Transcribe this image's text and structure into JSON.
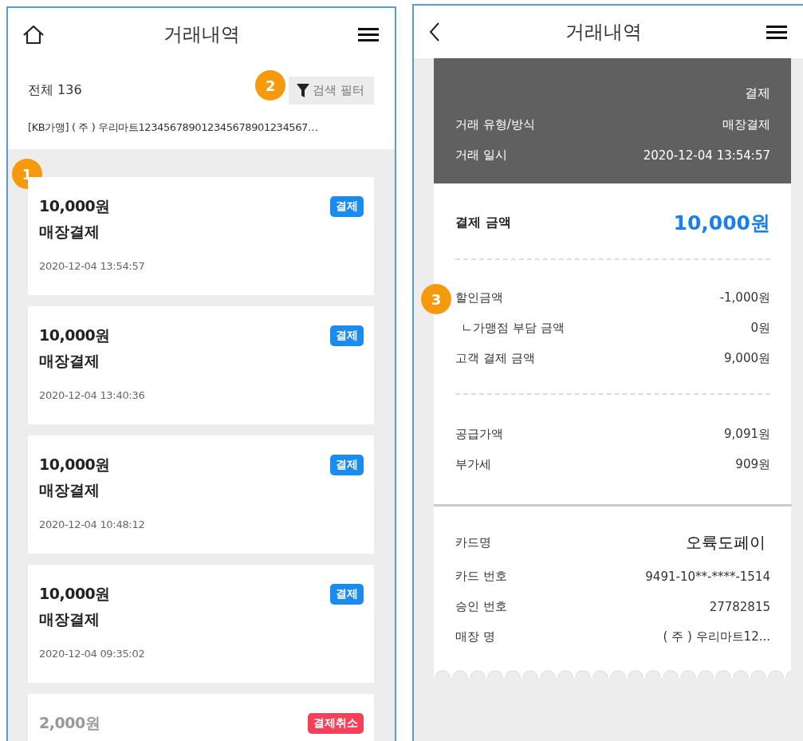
{
  "list_screen": {
    "title": "거래내역",
    "total": "전체 136",
    "filter_button": "검색 필터",
    "filter_marker": "2",
    "store": "[KB가맹] ( 주 ) 우리마트123456789012345678901234567…",
    "list_marker": "1",
    "transactions": [
      {
        "kind": "payment",
        "amount": "10,000원",
        "method": "매장결제",
        "datetime": "2020-12-04 13:54:57",
        "badge": "결제"
      },
      {
        "kind": "payment",
        "amount": "10,000원",
        "method": "매장결제",
        "datetime": "2020-12-04 13:40:36",
        "badge": "결제"
      },
      {
        "kind": "payment",
        "amount": "10,000원",
        "method": "매장결제",
        "datetime": "2020-12-04 10:48:12",
        "badge": "결제"
      },
      {
        "kind": "payment",
        "amount": "10,000원",
        "method": "매장결제",
        "datetime": "2020-12-04 09:35:02",
        "badge": "결제"
      },
      {
        "kind": "cancel",
        "amount": "2,000원",
        "badge": "결제취소"
      }
    ]
  },
  "detail_screen": {
    "title": "거래내역",
    "summary_type": "결제",
    "summary_rows": [
      {
        "label": "거래 유형/방식",
        "value": "매장결제"
      },
      {
        "label": "거래 일시",
        "value": "2020-12-04 13:54:57"
      }
    ],
    "amount": {
      "label": "결제 금액",
      "value": "10,000원"
    },
    "discount_marker": "3",
    "discount_rows": [
      {
        "kind": "main",
        "label": "할인금액",
        "value": "-1,000원"
      },
      {
        "kind": "sub",
        "label": "ㄴ가맹점 부담 금액",
        "value": "0원"
      },
      {
        "kind": "main",
        "label": "고객 결제 금액",
        "value": "9,000원"
      }
    ],
    "tax_rows": [
      {
        "label": "공급가액",
        "value": "9,091원"
      },
      {
        "label": "부가세",
        "value": "909원"
      }
    ],
    "card_rows": [
      {
        "kind": "large",
        "label": "카드명",
        "value": "오륙도페이"
      },
      {
        "kind": "main",
        "label": "카드 번호",
        "value": "9491-10**-****-1514"
      },
      {
        "kind": "main",
        "label": "승인 번호",
        "value": "27782815"
      },
      {
        "kind": "main",
        "label": "매장 명",
        "value": "( 주 ) 우리마트12..."
      }
    ]
  }
}
